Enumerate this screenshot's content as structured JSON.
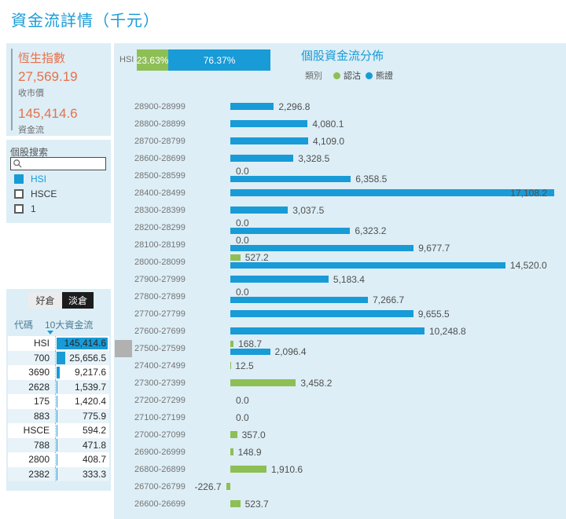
{
  "page": {
    "title": "資金流詳情（千元）"
  },
  "colors": {
    "blue": "#189bd7",
    "green": "#8ebf55",
    "orange": "#e7714a",
    "panel_bg": "#ddeef6",
    "black_btn": "#1c1c1c"
  },
  "index_card": {
    "name": "恆生指數",
    "close_price": "27,569.19",
    "close_price_label": "收市價",
    "fund_flow": "145,414.6",
    "fund_flow_label": "資金流"
  },
  "search_card": {
    "label": "個股搜索",
    "placeholder": "",
    "search_icon": "magnifier-icon",
    "options": [
      {
        "label": "HSI",
        "checked": true
      },
      {
        "label": "HSCE",
        "checked": false
      },
      {
        "label": "1",
        "checked": false
      }
    ]
  },
  "position_card": {
    "buttons": [
      {
        "label": "好倉",
        "active": false
      },
      {
        "label": "淡倉",
        "active": true
      }
    ],
    "table": {
      "col_code": "代碼",
      "col_flow": "10大資金流",
      "sort_icon": "sort-desc-triangle",
      "max_value": 145414.6,
      "rows": [
        {
          "code": "HSI",
          "value": 145414.6,
          "label": "145,414.6"
        },
        {
          "code": "700",
          "value": 25656.5,
          "label": "25,656.5"
        },
        {
          "code": "3690",
          "value": 9217.6,
          "label": "9,217.6"
        },
        {
          "code": "2628",
          "value": 1539.7,
          "label": "1,539.7"
        },
        {
          "code": "175",
          "value": 1420.4,
          "label": "1,420.4"
        },
        {
          "code": "883",
          "value": 775.9,
          "label": "775.9"
        },
        {
          "code": "HSCE",
          "value": 594.2,
          "label": "594.2"
        },
        {
          "code": "788",
          "value": 471.8,
          "label": "471.8"
        },
        {
          "code": "2800",
          "value": 408.7,
          "label": "408.7"
        },
        {
          "code": "2382",
          "value": 333.3,
          "label": "333.3"
        }
      ]
    }
  },
  "ratio_bar": {
    "label": "HSI",
    "segments": [
      {
        "name": "認沽",
        "pct_label": "23.63%",
        "pct": 23.63,
        "color": "#8ebf55"
      },
      {
        "name": "熊證",
        "pct_label": "76.37%",
        "pct": 76.37,
        "color": "#189bd7"
      }
    ]
  },
  "chart_data": {
    "type": "bar",
    "orientation": "horizontal",
    "title": "個股資金流分佈",
    "legend_title": "類別",
    "legend_position": "top",
    "unit": "千元",
    "series": [
      {
        "name": "認沽",
        "color": "#8ebf55"
      },
      {
        "name": "熊證",
        "color": "#189bd7"
      }
    ],
    "x_range": [
      0,
      17710
    ],
    "categories": [
      "28900-28999",
      "28800-28899",
      "28700-28799",
      "28600-28699",
      "28500-28599",
      "28400-28499",
      "28300-28399",
      "28200-28299",
      "28100-28199",
      "28000-28099",
      "27900-27999",
      "27800-27899",
      "27700-27799",
      "27600-27699",
      "27500-27599",
      "27400-27499",
      "27300-27399",
      "27200-27299",
      "27100-27199",
      "27000-27099",
      "26900-26999",
      "26800-26899",
      "26700-26799",
      "26600-26699"
    ],
    "rows": [
      {
        "category": "28900-28999",
        "put": null,
        "put_label": null,
        "bear": 2296.8,
        "bear_label": "2,296.8",
        "marker": false
      },
      {
        "category": "28800-28899",
        "put": null,
        "put_label": null,
        "bear": 4080.1,
        "bear_label": "4,080.1",
        "marker": false
      },
      {
        "category": "28700-28799",
        "put": null,
        "put_label": null,
        "bear": 4109.0,
        "bear_label": "4,109.0",
        "marker": false
      },
      {
        "category": "28600-28699",
        "put": null,
        "put_label": null,
        "bear": 3328.5,
        "bear_label": "3,328.5",
        "marker": false
      },
      {
        "category": "28500-28599",
        "put": 0,
        "put_label": "0.0",
        "bear": 6358.5,
        "bear_label": "6,358.5",
        "marker": false
      },
      {
        "category": "28400-28499",
        "put": null,
        "put_label": null,
        "bear": 17108.2,
        "bear_label": "17,108.2",
        "marker": false
      },
      {
        "category": "28300-28399",
        "put": null,
        "put_label": null,
        "bear": 3037.5,
        "bear_label": "3,037.5",
        "marker": false
      },
      {
        "category": "28200-28299",
        "put": 0,
        "put_label": "0.0",
        "bear": 6323.2,
        "bear_label": "6,323.2",
        "marker": false
      },
      {
        "category": "28100-28199",
        "put": 0,
        "put_label": "0.0",
        "bear": 9677.7,
        "bear_label": "9,677.7",
        "marker": false
      },
      {
        "category": "28000-28099",
        "put": 527.2,
        "put_label": "527.2",
        "bear": 14520.0,
        "bear_label": "14,520.0",
        "marker": false
      },
      {
        "category": "27900-27999",
        "put": null,
        "put_label": null,
        "bear": 5183.4,
        "bear_label": "5,183.4",
        "marker": false
      },
      {
        "category": "27800-27899",
        "put": 0,
        "put_label": "0.0",
        "bear": 7266.7,
        "bear_label": "7,266.7",
        "marker": false
      },
      {
        "category": "27700-27799",
        "put": null,
        "put_label": null,
        "bear": 9655.5,
        "bear_label": "9,655.5",
        "marker": false
      },
      {
        "category": "27600-27699",
        "put": null,
        "put_label": null,
        "bear": 10248.8,
        "bear_label": "10,248.8",
        "marker": false
      },
      {
        "category": "27500-27599",
        "put": 168.7,
        "put_label": "168.7",
        "bear": 2096.4,
        "bear_label": "2,096.4",
        "marker": true
      },
      {
        "category": "27400-27499",
        "put": 12.5,
        "put_label": "12.5",
        "bear": null,
        "bear_label": null,
        "marker": false
      },
      {
        "category": "27300-27399",
        "put": 3458.2,
        "put_label": "3,458.2",
        "bear": null,
        "bear_label": null,
        "marker": false
      },
      {
        "category": "27200-27299",
        "put": 0,
        "put_label": "0.0",
        "bear": null,
        "bear_label": null,
        "marker": false
      },
      {
        "category": "27100-27199",
        "put": 0,
        "put_label": "0.0",
        "bear": null,
        "bear_label": null,
        "marker": false
      },
      {
        "category": "27000-27099",
        "put": 357.0,
        "put_label": "357.0",
        "bear": null,
        "bear_label": null,
        "marker": false
      },
      {
        "category": "26900-26999",
        "put": 148.9,
        "put_label": "148.9",
        "bear": null,
        "bear_label": null,
        "marker": false
      },
      {
        "category": "26800-26899",
        "put": 1910.6,
        "put_label": "1,910.6",
        "bear": null,
        "bear_label": null,
        "marker": false
      },
      {
        "category": "26700-26799",
        "put": -226.7,
        "put_label": "-226.7",
        "bear": null,
        "bear_label": null,
        "marker": false
      },
      {
        "category": "26600-26699",
        "put": 523.7,
        "put_label": "523.7",
        "bear": null,
        "bear_label": null,
        "marker": false
      }
    ]
  }
}
